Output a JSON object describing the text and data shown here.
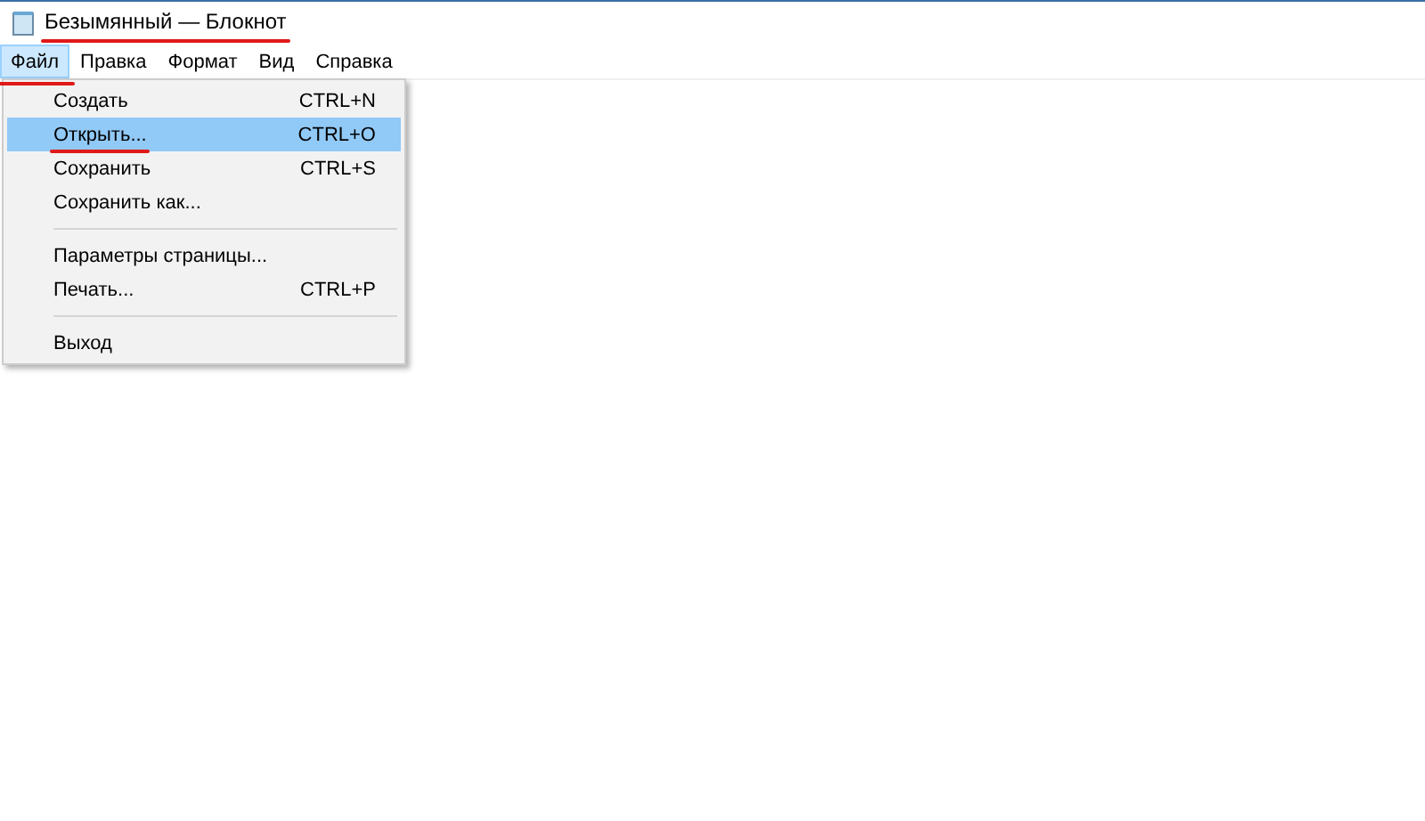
{
  "window": {
    "title": "Безымянный — Блокнот",
    "underlined": true
  },
  "menubar": [
    {
      "label": "Файл",
      "selected": true,
      "underlined": true
    },
    {
      "label": "Правка",
      "selected": false,
      "underlined": false
    },
    {
      "label": "Формат",
      "selected": false,
      "underlined": false
    },
    {
      "label": "Вид",
      "selected": false,
      "underlined": false
    },
    {
      "label": "Справка",
      "selected": false,
      "underlined": false
    }
  ],
  "menu": [
    {
      "kind": "item",
      "label": "Создать",
      "shortcut": "CTRL+N",
      "selected": false,
      "underlined": false
    },
    {
      "kind": "item",
      "label": "Открыть...",
      "shortcut": "CTRL+O",
      "selected": true,
      "underlined": true
    },
    {
      "kind": "item",
      "label": "Сохранить",
      "shortcut": "CTRL+S",
      "selected": false,
      "underlined": false
    },
    {
      "kind": "item",
      "label": "Сохранить как...",
      "selected": false,
      "underlined": false
    },
    {
      "kind": "separator"
    },
    {
      "kind": "item",
      "label": "Параметры страницы...",
      "selected": false,
      "underlined": false
    },
    {
      "kind": "item",
      "label": "Печать...",
      "shortcut": "CTRL+P",
      "selected": false,
      "underlined": false
    },
    {
      "kind": "separator"
    },
    {
      "kind": "item",
      "label": "Выход",
      "selected": false,
      "underlined": false
    }
  ]
}
